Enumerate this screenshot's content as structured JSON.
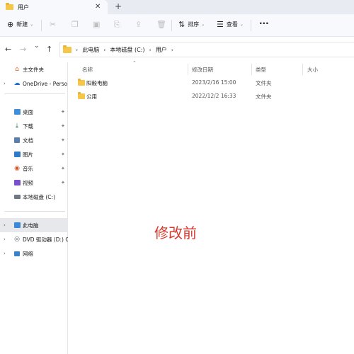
{
  "window": {
    "tab_title": "用户",
    "close_glyph": "✕",
    "new_tab_glyph": "+"
  },
  "toolbar": {
    "new_label": "新建",
    "new_icon": "plus-circle-icon",
    "sort_label": "排序",
    "view_label": "查看",
    "more_glyph": "···"
  },
  "navigation": {
    "back_glyph": "←",
    "forward_glyph": "→",
    "down_glyph": "⌄",
    "up_glyph": "↑",
    "breadcrumb": [
      "此电脑",
      "本地磁盘 (C:)",
      "用户"
    ],
    "crumb_separator": "›"
  },
  "sidebar": {
    "items": [
      {
        "label": "主文件夹",
        "icon": "home-icon",
        "chevron": "",
        "pinned": false
      },
      {
        "label": "OneDrive - Perso",
        "icon": "cloud-icon",
        "chevron": "›",
        "pinned": false
      },
      {
        "label": "桌面",
        "icon": "desktop-icon",
        "chevron": "",
        "pinned": true
      },
      {
        "label": "下载",
        "icon": "download-icon",
        "chevron": "",
        "pinned": true
      },
      {
        "label": "文档",
        "icon": "document-icon",
        "chevron": "",
        "pinned": true
      },
      {
        "label": "图片",
        "icon": "picture-icon",
        "chevron": "",
        "pinned": true
      },
      {
        "label": "音乐",
        "icon": "music-icon",
        "chevron": "",
        "pinned": true
      },
      {
        "label": "视频",
        "icon": "video-icon",
        "chevron": "",
        "pinned": true
      },
      {
        "label": "本地磁盘 (C:)",
        "icon": "drive-icon",
        "chevron": "",
        "pinned": false
      },
      {
        "label": "此电脑",
        "icon": "computer-icon",
        "chevron": "›",
        "pinned": false,
        "selected": true
      },
      {
        "label": "DVD 驱动器 (D:) C",
        "icon": "dvd-icon",
        "chevron": "›",
        "pinned": false
      },
      {
        "label": "网络",
        "icon": "network-icon",
        "chevron": "›",
        "pinned": false
      }
    ],
    "pin_glyph": "📌"
  },
  "file_list": {
    "columns": [
      "名称",
      "修改日期",
      "类型",
      "大小"
    ],
    "sort_caret": "⌃",
    "rows": [
      {
        "name": "阳毅电脑",
        "modified": "2023/2/16 15:00",
        "type": "文件夹",
        "size": ""
      },
      {
        "name": "公用",
        "modified": "2022/12/2 16:33",
        "type": "文件夹",
        "size": ""
      }
    ]
  },
  "annotation": {
    "text": "修改前",
    "color": "#d83a2e"
  },
  "colors": {
    "folder": "#f4c74a",
    "selection": "#e6e8eb",
    "tabbar": "#e8ecf2"
  }
}
